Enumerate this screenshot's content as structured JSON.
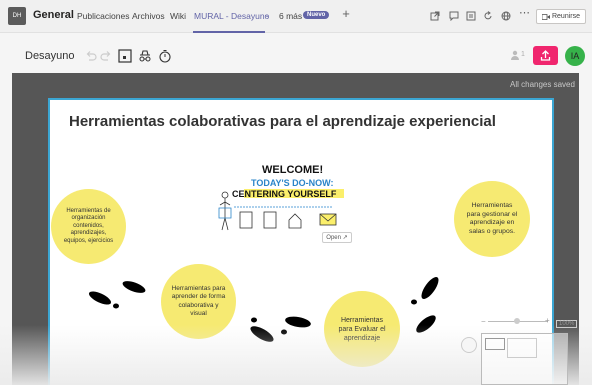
{
  "teams_bar": {
    "team_initials": "DH",
    "team_name": "General",
    "tabs": [
      {
        "label": "Publicaciones"
      },
      {
        "label": "Archivos"
      },
      {
        "label": "Wiki"
      },
      {
        "label": "MURAL - Desayuno"
      },
      {
        "label": "6 más"
      }
    ],
    "badge": "Nuevo",
    "join_button": "Reunirse"
  },
  "mural_toolbar": {
    "title": "Desayuno",
    "user_count": "1",
    "avatar_initials": "IA"
  },
  "status": {
    "saved": "All changes saved"
  },
  "board": {
    "title": "Herramientas colaborativas para el aprendizaje  experiencial",
    "circles": [
      {
        "text": "Herramientas de organización contenidos, aprendizajes, equipos, ejercicios"
      },
      {
        "text": "Herramientas para aprender de forma colaborativa y visual"
      },
      {
        "text": "Herramientas para Evaluar el aprendizaje"
      },
      {
        "text": "Herramientas para gestionar el aprendizaje en salas o grupos."
      }
    ],
    "welcome_card": {
      "line1": "WELCOME!",
      "line2": "TODAY'S DO-NOW:",
      "line3": "CENTERING YOURSELF",
      "open_label": "Open"
    }
  },
  "zoom": {
    "percent": "100%"
  },
  "colors": {
    "teams_accent": "#6264a7",
    "share_pink": "#f0266e",
    "avatar_green": "#36b24a",
    "sticky_yellow": "#f6ea72",
    "board_border": "#3ba6d3",
    "canvas_gray": "#565656"
  }
}
